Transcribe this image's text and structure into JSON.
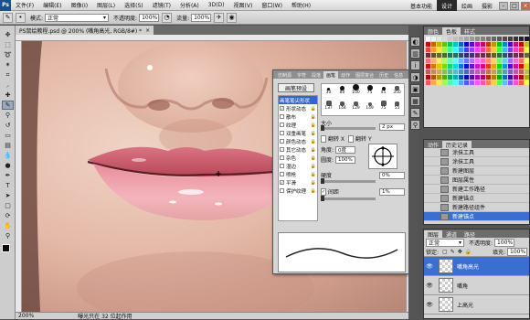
{
  "menubar": {
    "logo": "Ps",
    "items": [
      "文件(F)",
      "编辑(E)",
      "图像(I)",
      "图层(L)",
      "选择(S)",
      "滤镜(T)",
      "分析(A)",
      "3D(D)",
      "视图(V)",
      "窗口(W)",
      "帮助(H)"
    ],
    "workspaces": [
      "基本功能",
      "设计",
      "绘画",
      "摄影"
    ],
    "active_workspace": "设计",
    "window_buttons": [
      "–",
      "□",
      "×"
    ]
  },
  "options": {
    "mode_label": "模式:",
    "mode_value": "正常",
    "opacity_label": "不透明度:",
    "opacity_value": "100%",
    "flow_label": "流量:",
    "flow_value": "100%"
  },
  "document": {
    "tab_title": "PS鼠绘教程.psd @ 200% (嘴角高光, RGB/8#) *",
    "zoom": "200%",
    "status_text": "曝光只在 32 位起作用"
  },
  "brush_panel": {
    "tabs": [
      "仿制源",
      "字符",
      "段落",
      "画笔",
      "动作",
      "图层复合",
      "历史",
      "信息"
    ],
    "active_tab": "画笔",
    "preset_button": "画笔预设",
    "options": [
      {
        "label": "画笔笔尖形状",
        "checked": false,
        "selected": true
      },
      {
        "label": "形状动态",
        "checked": true,
        "selected": false
      },
      {
        "label": "散布",
        "checked": false,
        "selected": false
      },
      {
        "label": "纹理",
        "checked": false,
        "selected": false
      },
      {
        "label": "双重画笔",
        "checked": false,
        "selected": false
      },
      {
        "label": "颜色动态",
        "checked": false,
        "selected": false
      },
      {
        "label": "其它动态",
        "checked": false,
        "selected": false
      },
      {
        "label": "杂色",
        "checked": false,
        "selected": false
      },
      {
        "label": "湿边",
        "checked": false,
        "selected": false
      },
      {
        "label": "喷枪",
        "checked": false,
        "selected": false
      },
      {
        "label": "平滑",
        "checked": true,
        "selected": false
      },
      {
        "label": "保护纹理",
        "checked": false,
        "selected": false
      }
    ],
    "tips": [
      "30",
      "80",
      "100",
      "75",
      "45",
      "350",
      "137",
      "144",
      "129",
      "149",
      "75",
      "55",
      "45",
      "40",
      "65"
    ],
    "size_label": "大小",
    "size_value": "2 px",
    "flip_x": "翻转 X",
    "flip_y": "翻转 Y",
    "angle_label": "角度:",
    "angle_value": "0度",
    "roundness_label": "圆度:",
    "roundness_value": "100%",
    "hardness_label": "硬度",
    "hardness_value": "0%",
    "spacing_label": "间距",
    "spacing_value": "1%"
  },
  "swatches_panel": {
    "tabs": [
      "颜色",
      "色板",
      "样式"
    ],
    "active_tab": "色板"
  },
  "history_panel": {
    "tabs": [
      "动作",
      "历史记录"
    ],
    "active_tab": "历史记录",
    "items": [
      "涂抹工具",
      "涂抹工具",
      "新建图层",
      "图层属性",
      "新建工作路径",
      "新建锚点",
      "新建路径组件",
      "新建锚点"
    ],
    "selected_index": 7
  },
  "layers_panel": {
    "tabs": [
      "图层",
      "通道",
      "路径"
    ],
    "active_tab": "图层",
    "blend_mode": "正常",
    "opacity_label": "不透明度:",
    "opacity_value": "100%",
    "lock_label": "锁定:",
    "fill_label": "填充:",
    "fill_value": "100%",
    "layers": [
      {
        "name": "嘴角高光",
        "selected": true
      },
      {
        "name": "嘴角",
        "selected": false
      },
      {
        "name": "上高光",
        "selected": false
      }
    ]
  },
  "colors": {
    "selection_blue": "#3a6fd0",
    "lip_color": "#e58d9a"
  }
}
